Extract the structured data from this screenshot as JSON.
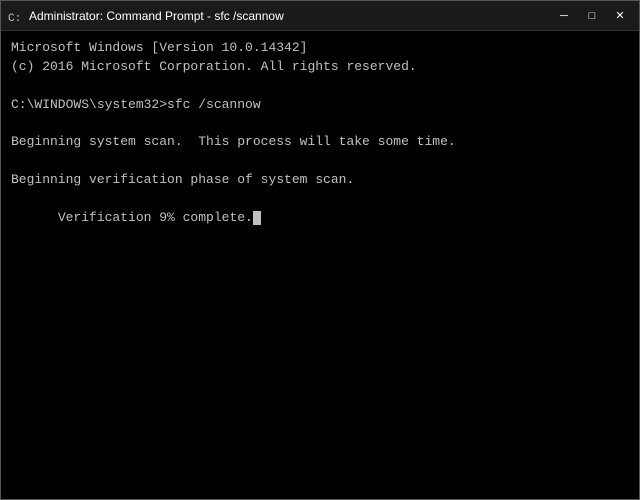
{
  "window": {
    "title": "Administrator: Command Prompt - sfc /scannow",
    "icon": "cmd-icon"
  },
  "titlebar": {
    "minimize_label": "─",
    "maximize_label": "□",
    "close_label": "✕"
  },
  "console": {
    "lines": [
      "Microsoft Windows [Version 10.0.14342]",
      "(c) 2016 Microsoft Corporation. All rights reserved.",
      "",
      "C:\\WINDOWS\\system32>sfc /scannow",
      "",
      "Beginning system scan.  This process will take some time.",
      "",
      "Beginning verification phase of system scan.",
      "Verification 9% complete."
    ]
  }
}
